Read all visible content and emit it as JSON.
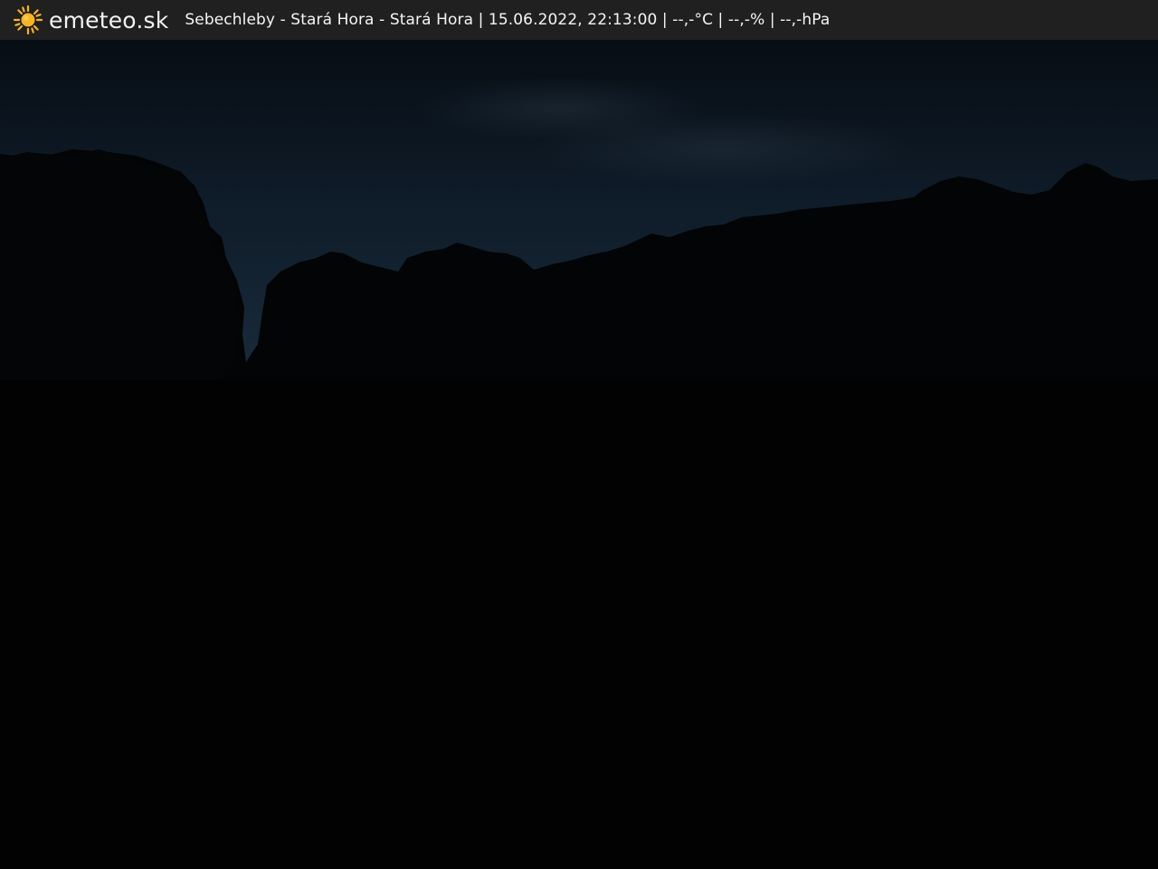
{
  "header": {
    "brand": "emeteo.sk",
    "logo_icon": "sun-icon",
    "caption": "Sebechleby - Stará Hora - Stará Hora | 15.06.2022, 22:13:00 | --,-°C | --,-% | --,-hPa"
  },
  "colors": {
    "bar_background": "#202020",
    "sun": "#f7b41e",
    "sky_top": "#081018",
    "sky_horizon": "#17293a",
    "ground": "#020203"
  }
}
